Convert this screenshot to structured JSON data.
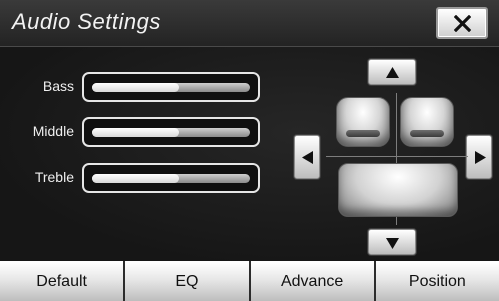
{
  "window": {
    "title": "Audio Settings",
    "close_icon": "close-x-icon"
  },
  "tone_controls": [
    {
      "label": "Bass",
      "level": 0.55
    },
    {
      "label": "Middle",
      "level": 0.55
    },
    {
      "label": "Treble",
      "level": 0.55
    }
  ],
  "balance_fader": {
    "up_icon": "arrow-up-icon",
    "down_icon": "arrow-down-icon",
    "left_icon": "arrow-left-icon",
    "right_icon": "arrow-right-icon",
    "seat_icon": "car-seat-icon"
  },
  "bottom_tabs": [
    {
      "label": "Default"
    },
    {
      "label": "EQ"
    },
    {
      "label": "Advance"
    },
    {
      "label": "Position"
    }
  ],
  "colors": {
    "background": "#1b1b1b",
    "button_face": "#e6e6e6",
    "text_light": "#f2f2f2",
    "text_dark": "#111111"
  }
}
